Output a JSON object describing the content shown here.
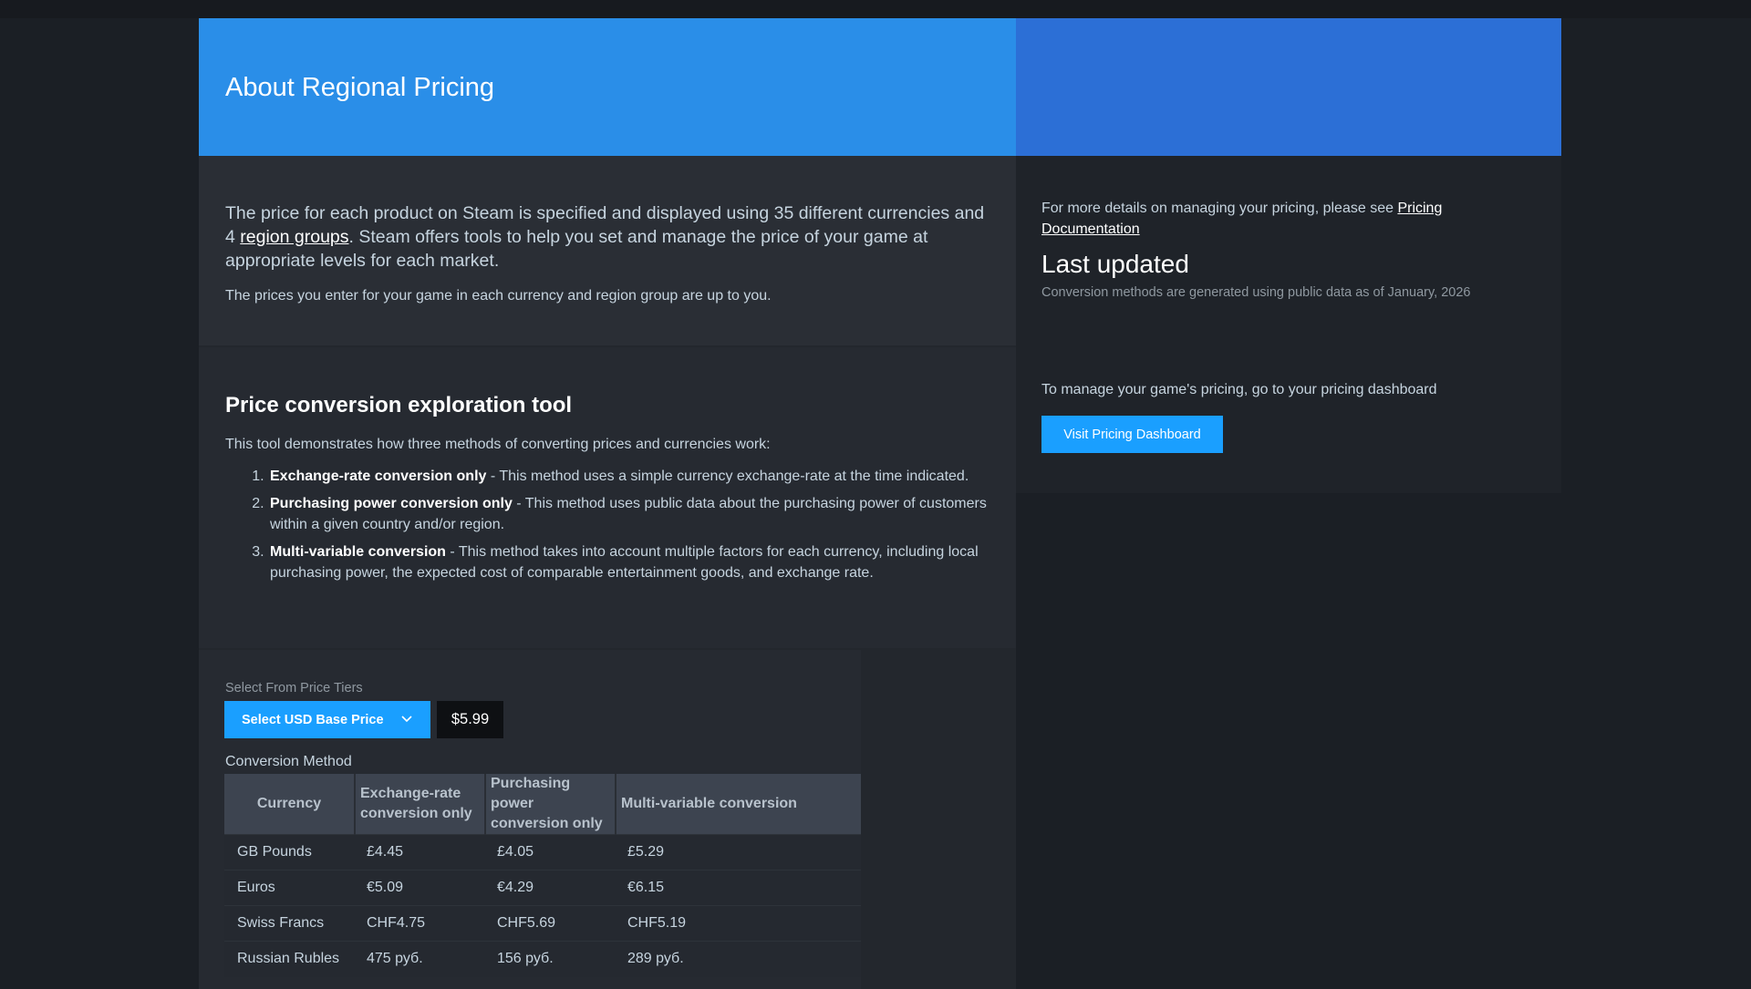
{
  "header": {
    "title": "About Regional Pricing"
  },
  "intro": {
    "paragraph_a": "The price for each product on Steam is specified and displayed using 35 different currencies and 4 ",
    "link_text": "region groups",
    "paragraph_b": ". Steam offers tools to help you set and manage the price of your game at appropriate levels for each market.",
    "small": "The prices you enter for your game in each currency and region group are up to you."
  },
  "tool": {
    "title": "Price conversion exploration tool",
    "description": "This tool demonstrates how three methods of converting prices and currencies work:",
    "methods": [
      {
        "name": "Exchange-rate conversion only",
        "text": " - This method uses a simple currency exchange-rate at the time indicated."
      },
      {
        "name": "Purchasing power conversion only",
        "text": " - This method uses public data about the purchasing power of customers within a given country and/or region."
      },
      {
        "name": "Multi-variable conversion",
        "text": " - This method takes into account multiple factors for each currency, including local purchasing power, the expected cost of comparable entertainment goods, and exchange rate."
      }
    ]
  },
  "converter": {
    "tier_label": "Select From Price Tiers",
    "tier_button": "Select USD Base Price",
    "price": "$5.99",
    "method_label": "Conversion Method",
    "headers": [
      "Currency",
      "Exchange-rate conversion only",
      "Purchasing power conversion only",
      "Multi-variable conversion"
    ],
    "rows": [
      [
        "GB Pounds",
        "£4.45",
        "£4.05",
        "£5.29"
      ],
      [
        "Euros",
        "€5.09",
        "€4.29",
        "€6.15"
      ],
      [
        "Swiss Francs",
        "CHF4.75",
        "CHF5.69",
        "CHF5.19"
      ],
      [
        "Russian Rubles",
        "475 руб.",
        "156 руб.",
        "289 руб."
      ]
    ]
  },
  "sidebar": {
    "more_text": "For more details on managing your pricing, please see ",
    "more_link": "Pricing Documentation",
    "last_updated_title": "Last updated",
    "last_updated_note": "Conversion methods are generated using public data as of January, 2026",
    "manage_text": "To manage your game's pricing, go to your pricing dashboard",
    "dashboard_button": "Visit Pricing Dashboard"
  },
  "icons": {
    "dropdown": "chevron-down-icon"
  },
  "colors": {
    "accent": "#1a9fff",
    "header_left": "#2a8ee8",
    "header_right": "#2c6fd6"
  }
}
